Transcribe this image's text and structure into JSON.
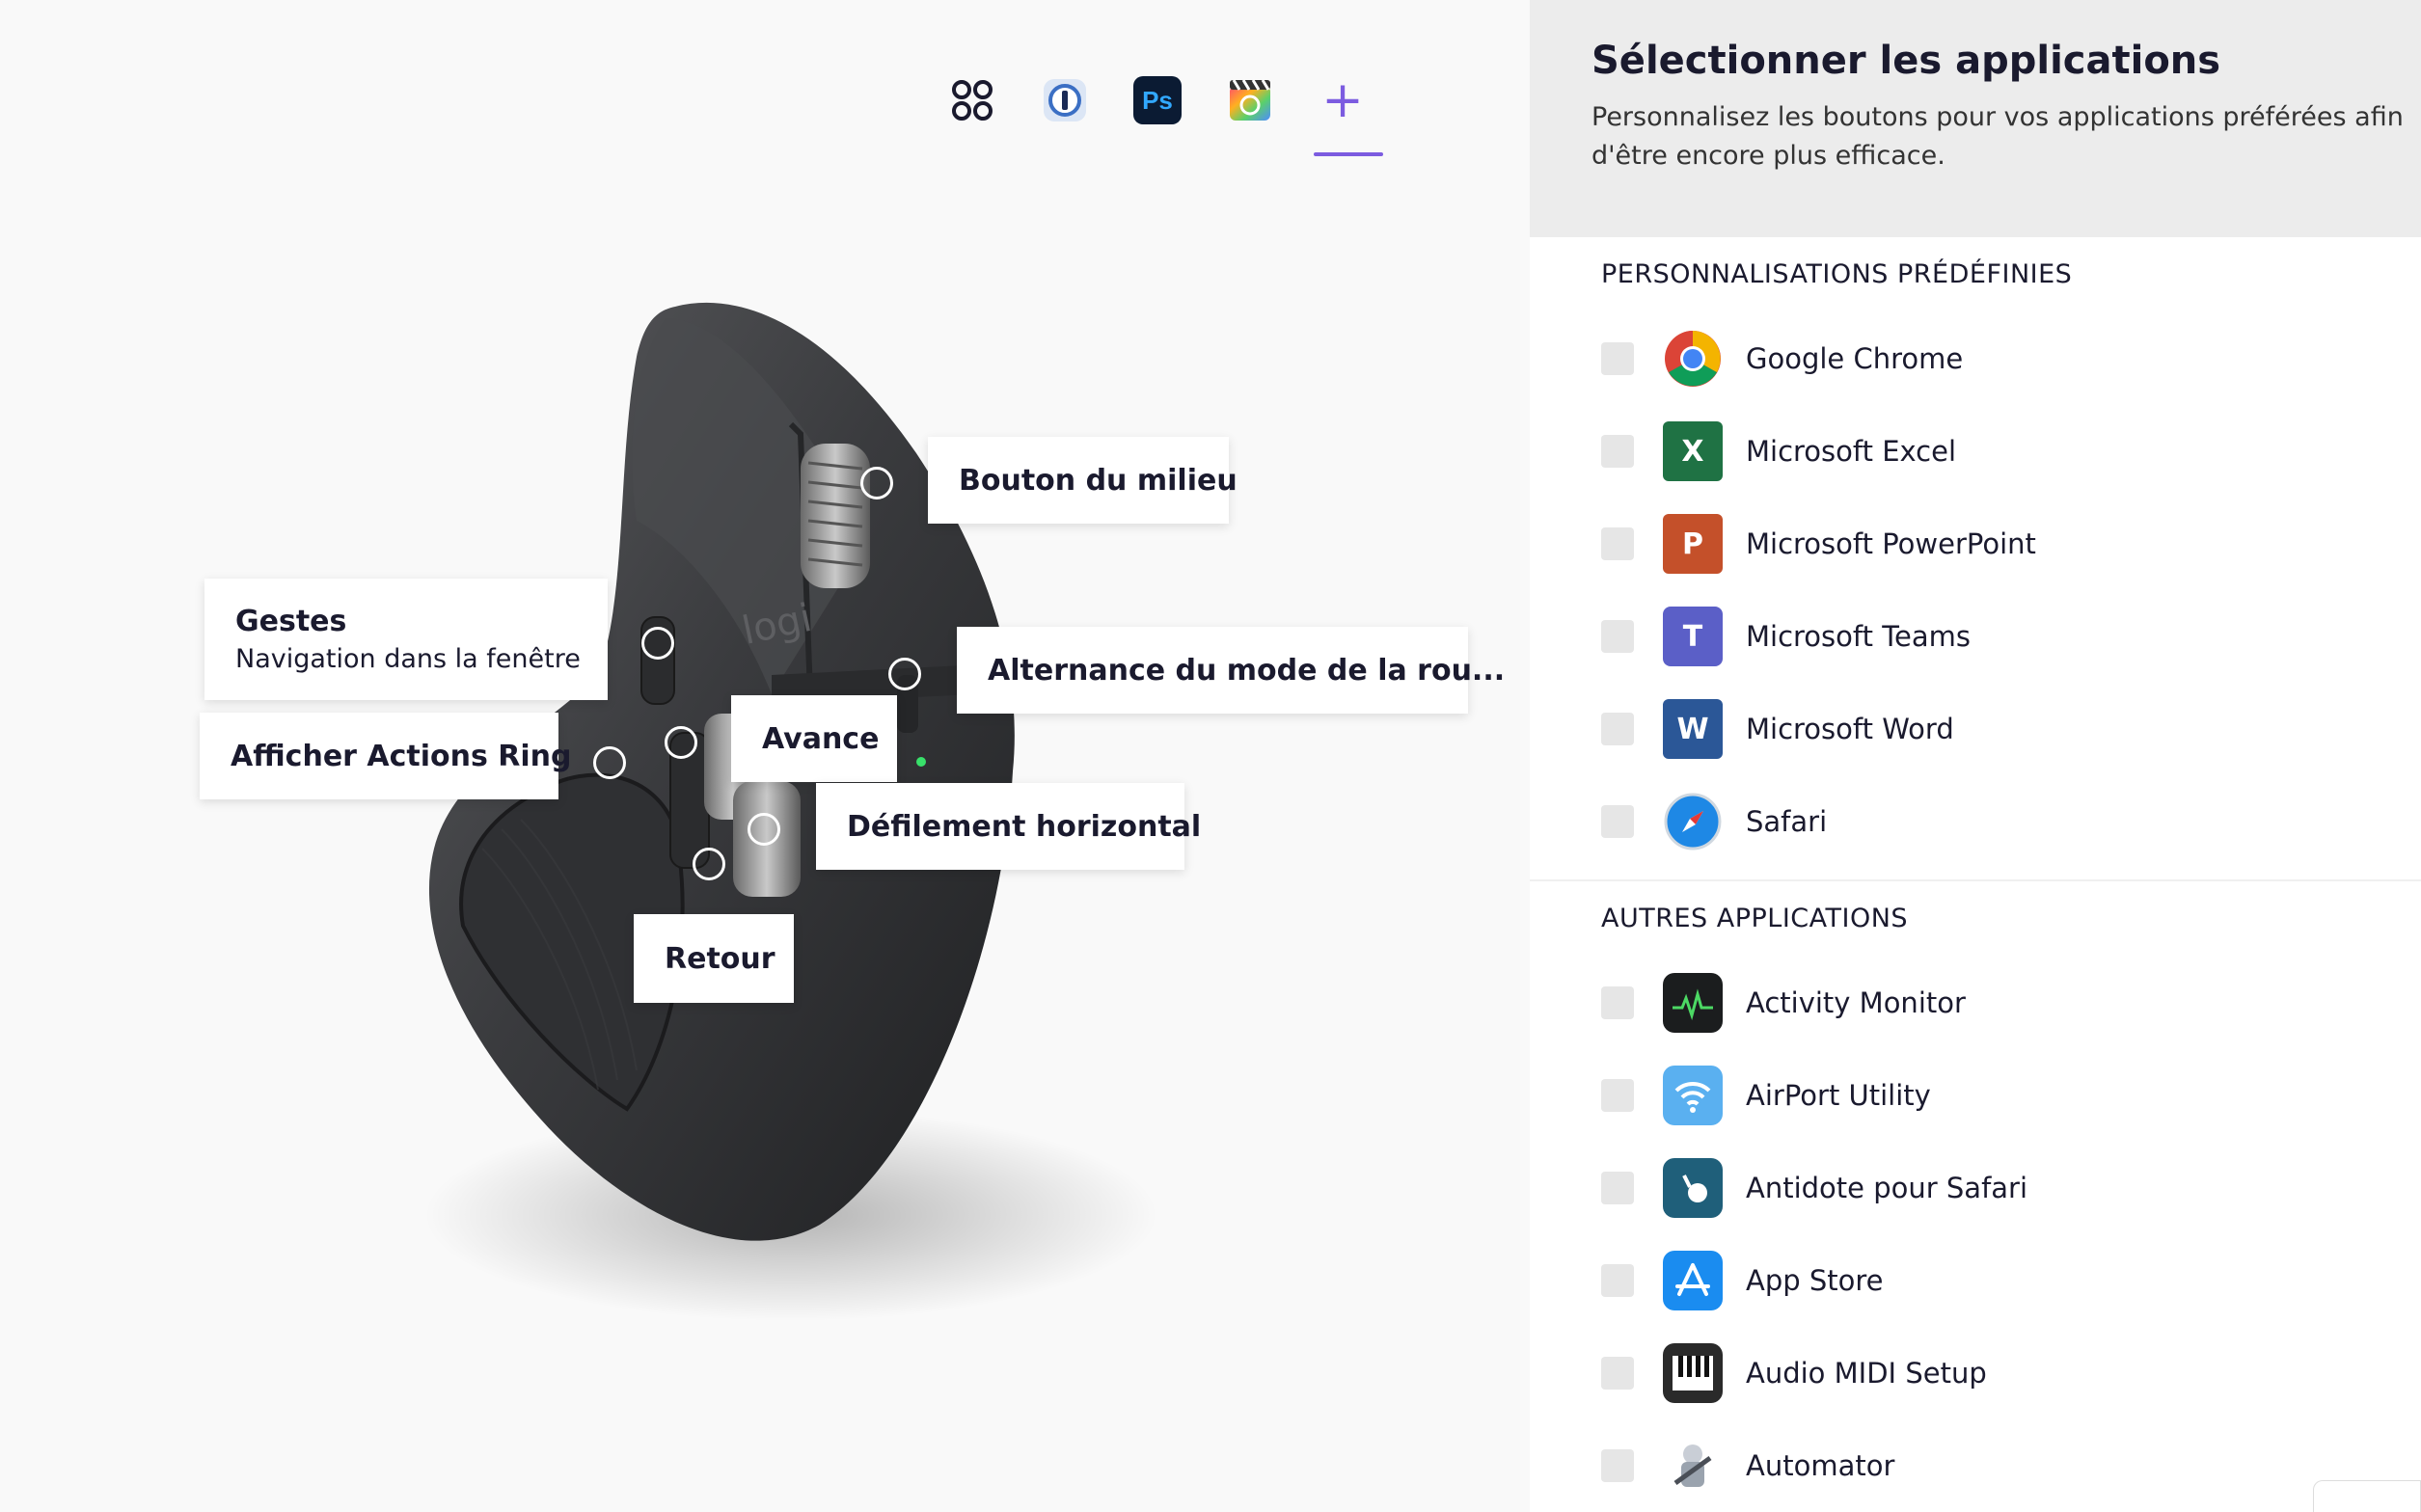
{
  "appbar": {
    "items": [
      {
        "name": "all-apps",
        "label": ""
      },
      {
        "name": "1password",
        "label": ""
      },
      {
        "name": "photoshop",
        "label": "Ps"
      },
      {
        "name": "final-cut-pro",
        "label": ""
      },
      {
        "name": "add-app",
        "label": "+"
      }
    ],
    "accent": "#7c5ce0"
  },
  "callouts": {
    "middle_button": "Bouton du milieu",
    "gestures_title": "Gestes",
    "gestures_sub": "Navigation dans la fenêtre",
    "scroll_mode": "Alternance du mode de la rou...",
    "actions_ring": "Afficher Actions Ring",
    "forward": "Avance",
    "horizontal_scroll": "Défilement horizontal",
    "back": "Retour"
  },
  "mouse": {
    "logo": "logi"
  },
  "panel": {
    "title": "Sélectionner les applications",
    "description": "Personnalisez les boutons pour vos applications préférées afin d'être encore plus efficace.",
    "predefined_header": "PERSONNALISATIONS PRÉDÉFINIES",
    "predefined": [
      {
        "label": "Google Chrome",
        "icon": "chrome-icon",
        "icon_text": ""
      },
      {
        "label": "Microsoft Excel",
        "icon": "excel-icon",
        "icon_text": "X"
      },
      {
        "label": "Microsoft PowerPoint",
        "icon": "powerpoint-icon",
        "icon_text": "P"
      },
      {
        "label": "Microsoft Teams",
        "icon": "teams-icon",
        "icon_text": "T"
      },
      {
        "label": "Microsoft Word",
        "icon": "word-icon",
        "icon_text": "W"
      },
      {
        "label": "Safari",
        "icon": "safari-icon",
        "icon_text": ""
      }
    ],
    "other_header": "AUTRES APPLICATIONS",
    "other": [
      {
        "label": "Activity Monitor",
        "icon": "activity-monitor-icon",
        "icon_text": ""
      },
      {
        "label": "AirPort Utility",
        "icon": "airport-utility-icon",
        "icon_text": ""
      },
      {
        "label": "Antidote pour Safari",
        "icon": "antidote-icon",
        "icon_text": ""
      },
      {
        "label": "App Store",
        "icon": "app-store-icon",
        "icon_text": ""
      },
      {
        "label": "Audio MIDI Setup",
        "icon": "audio-midi-icon",
        "icon_text": ""
      },
      {
        "label": "Automator",
        "icon": "automator-icon",
        "icon_text": ""
      }
    ]
  }
}
